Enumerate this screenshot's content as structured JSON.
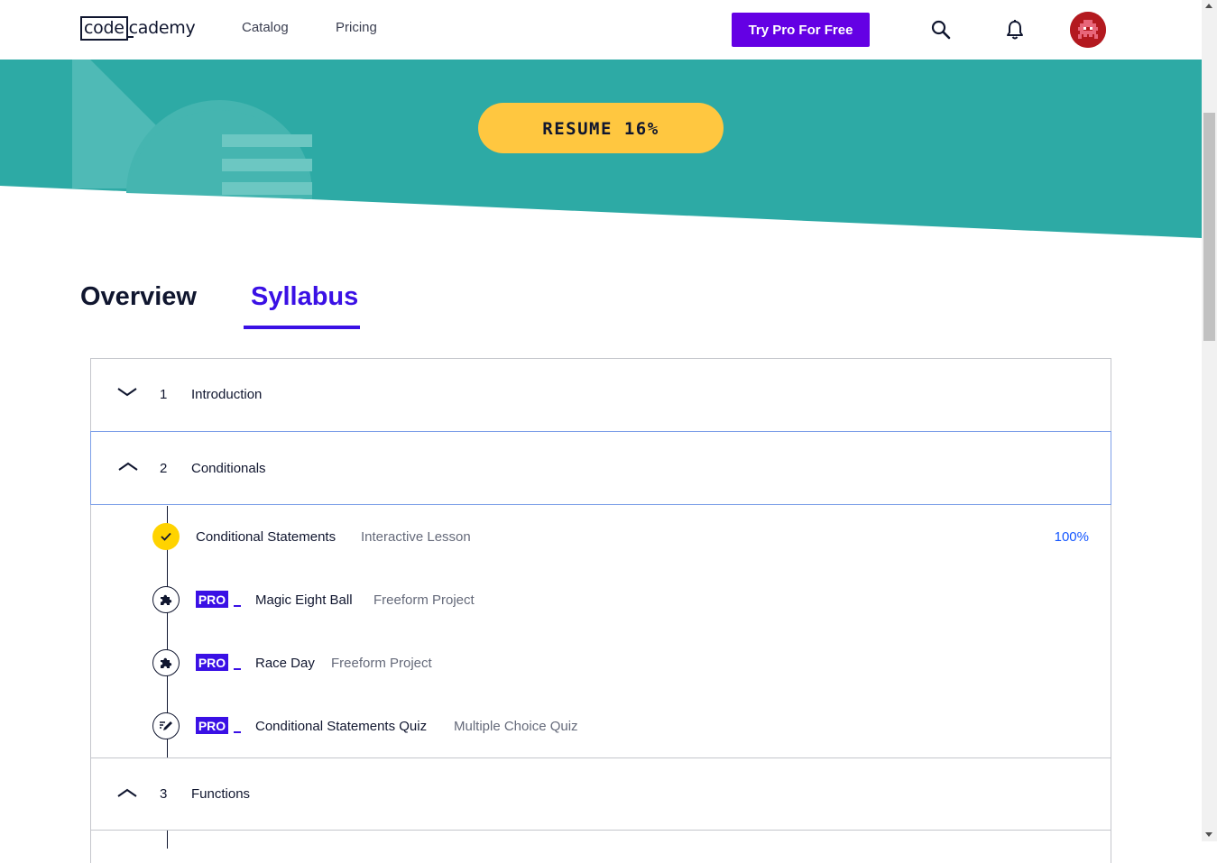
{
  "header": {
    "logo_code": "code",
    "logo_rest": "cademy",
    "nav": [
      "Catalog",
      "Pricing"
    ],
    "cta_label": "Try Pro For Free",
    "icons": [
      "search-icon",
      "bell-icon",
      "avatar"
    ]
  },
  "hero": {
    "resume_label": "RESUME 16%",
    "resume_progress": 0.16,
    "colors": {
      "teal": "#2daaa5",
      "yellow": "#ffc740"
    }
  },
  "tabs": {
    "overview": "Overview",
    "syllabus": "Syllabus",
    "active": "Syllabus"
  },
  "syllabus": {
    "modules": [
      {
        "number": "1",
        "title": "Introduction",
        "state": "collapsed"
      },
      {
        "number": "2",
        "title": "Conditionals",
        "state": "expanded",
        "items": [
          {
            "title": "Conditional Statements",
            "type": "Interactive Lesson",
            "progress": "100%",
            "pro": false,
            "icon": "check-icon"
          },
          {
            "title": "Magic Eight Ball",
            "type": "Freeform Project",
            "pro": true,
            "pro_label": "PRO",
            "icon": "puzzle-icon"
          },
          {
            "title": "Race Day",
            "type": "Freeform Project",
            "pro": true,
            "pro_label": "PRO",
            "icon": "puzzle-icon"
          },
          {
            "title": "Conditional Statements Quiz",
            "type": "Multiple Choice Quiz",
            "pro": true,
            "pro_label": "PRO",
            "icon": "quiz-pencil-icon"
          }
        ]
      },
      {
        "number": "3",
        "title": "Functions",
        "state": "expanded"
      }
    ]
  },
  "colors": {
    "brand_purple": "#3a10e5",
    "cta_purple": "#6400e4",
    "link_blue": "#1557ff"
  }
}
